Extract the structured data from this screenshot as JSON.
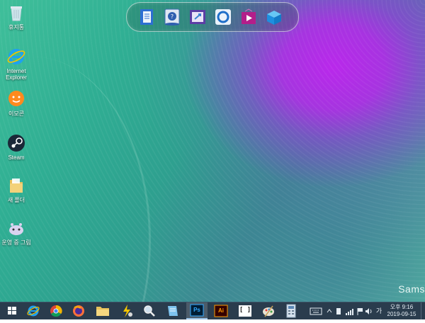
{
  "desktop": {
    "brand_text": "Sams",
    "icons": [
      {
        "label": "휴지통",
        "icon": "recycle-bin-icon"
      },
      {
        "label": "Internet Explorer",
        "icon": "internet-explorer-icon"
      },
      {
        "label": "이모콘",
        "icon": "emoticon-icon"
      },
      {
        "label": "Steam",
        "icon": "steam-icon"
      },
      {
        "label": "새 폴더",
        "icon": "folder-icon"
      },
      {
        "label": "운영 중 그림",
        "icon": "mascot-icon"
      }
    ]
  },
  "dock": {
    "items": [
      {
        "icon": "notebook-app-icon"
      },
      {
        "icon": "help-app-icon"
      },
      {
        "icon": "file-transfer-app-icon"
      },
      {
        "icon": "ring-app-icon"
      },
      {
        "icon": "video-app-icon"
      },
      {
        "icon": "box-app-icon"
      }
    ]
  },
  "taskbar": {
    "apps": [
      {
        "icon": "windows-start-icon"
      },
      {
        "icon": "internet-explorer-icon"
      },
      {
        "icon": "chrome-icon"
      },
      {
        "icon": "firefox-icon"
      },
      {
        "icon": "file-explorer-icon"
      },
      {
        "icon": "flash-tool-icon"
      },
      {
        "icon": "magnifier-icon"
      },
      {
        "icon": "notepad-icon"
      },
      {
        "icon": "photoshop-icon",
        "label": "Ps"
      },
      {
        "icon": "illustrator-icon",
        "label": "Ai"
      },
      {
        "icon": "brackets-icon",
        "label": "[ ]"
      },
      {
        "icon": "paint-icon"
      },
      {
        "icon": "calculator-icon"
      }
    ],
    "tray": {
      "input_label": "가",
      "time": "오후 9:16",
      "date": "2019-09-15"
    }
  },
  "colors": {
    "taskbar": "#2a3c4d",
    "wallpaper_teal": "#2fae93",
    "wallpaper_purple": "#b928eb"
  }
}
